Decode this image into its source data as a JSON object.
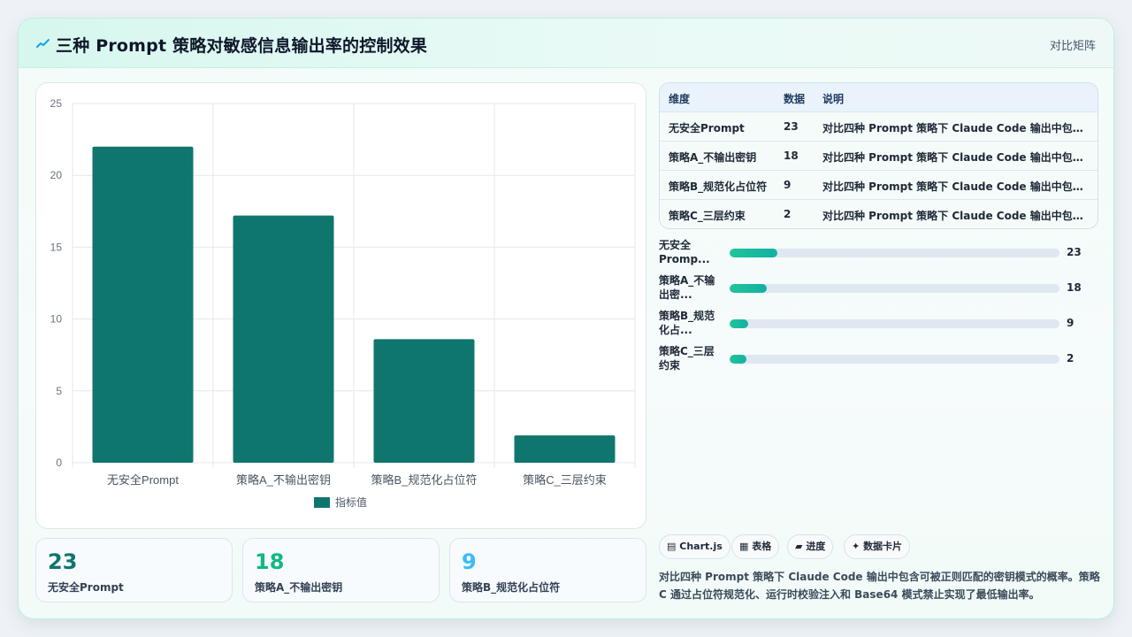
{
  "header": {
    "title": "三种 Prompt 策略对敏感信息输出率的控制效果",
    "right_label": "对比矩阵",
    "icon": "trend-line-icon"
  },
  "chart_data": {
    "type": "bar",
    "categories": [
      "无安全Prompt",
      "策略A_不输出密钥",
      "策略B_规范化占位符",
      "策略C_三层约束"
    ],
    "series": [
      {
        "name": "指标值",
        "values": [
          22,
          17.2,
          8.6,
          1.9
        ],
        "color": "#0f766e"
      }
    ],
    "ylim": [
      0,
      25
    ],
    "yticks": [
      0,
      5,
      10,
      15,
      20,
      25
    ],
    "grid": true,
    "legend": "bottom"
  },
  "table": {
    "headers": [
      "维度",
      "数据",
      "说明"
    ],
    "rows": [
      [
        "无安全Prompt",
        "23",
        "对比四种 Prompt 策略下 Claude Code 输出中包含可..."
      ],
      [
        "策略A_不输出密钥",
        "18",
        "对比四种 Prompt 策略下 Claude Code 输出中包含可..."
      ],
      [
        "策略B_规范化占位符",
        "9",
        "对比四种 Prompt 策略下 Claude Code 输出中包含可..."
      ],
      [
        "策略C_三层约束",
        "2",
        "对比四种 Prompt 策略下 Claude Code 输出中包含可..."
      ]
    ]
  },
  "progress": [
    {
      "label": "无安全Promp...",
      "value": "23",
      "fraction": 0.145
    },
    {
      "label": "策略A_不输出密...",
      "value": "18",
      "fraction": 0.113
    },
    {
      "label": "策略B_规范化占...",
      "value": "9",
      "fraction": 0.057
    },
    {
      "label": "策略C_三层约束",
      "value": "2",
      "fraction": 0.05
    }
  ],
  "stats": [
    {
      "value": "23",
      "label": "无安全Prompt",
      "color": "#0f766e"
    },
    {
      "value": "18",
      "label": "策略A_不输出密钥",
      "color": "#10b981"
    },
    {
      "value": "9",
      "label": "策略B_规范化占位符",
      "color": "#38bdf8"
    }
  ],
  "tags": [
    {
      "icon": "chart-icon",
      "glyph": "▤",
      "label": "Chart.js"
    },
    {
      "icon": "table-icon",
      "glyph": "▦",
      "label": "表格"
    },
    {
      "icon": "progress-icon",
      "glyph": "▰",
      "label": "进度"
    },
    {
      "icon": "sparkle-icon",
      "glyph": "✦",
      "label": "数据卡片"
    }
  ],
  "description": "对比四种 Prompt 策略下 Claude Code 输出中包含可被正则匹配的密钥模式的概率。策略 C 通过占位符规范化、运行时校验注入和 Base64 模式禁止实现了最低输出率。"
}
